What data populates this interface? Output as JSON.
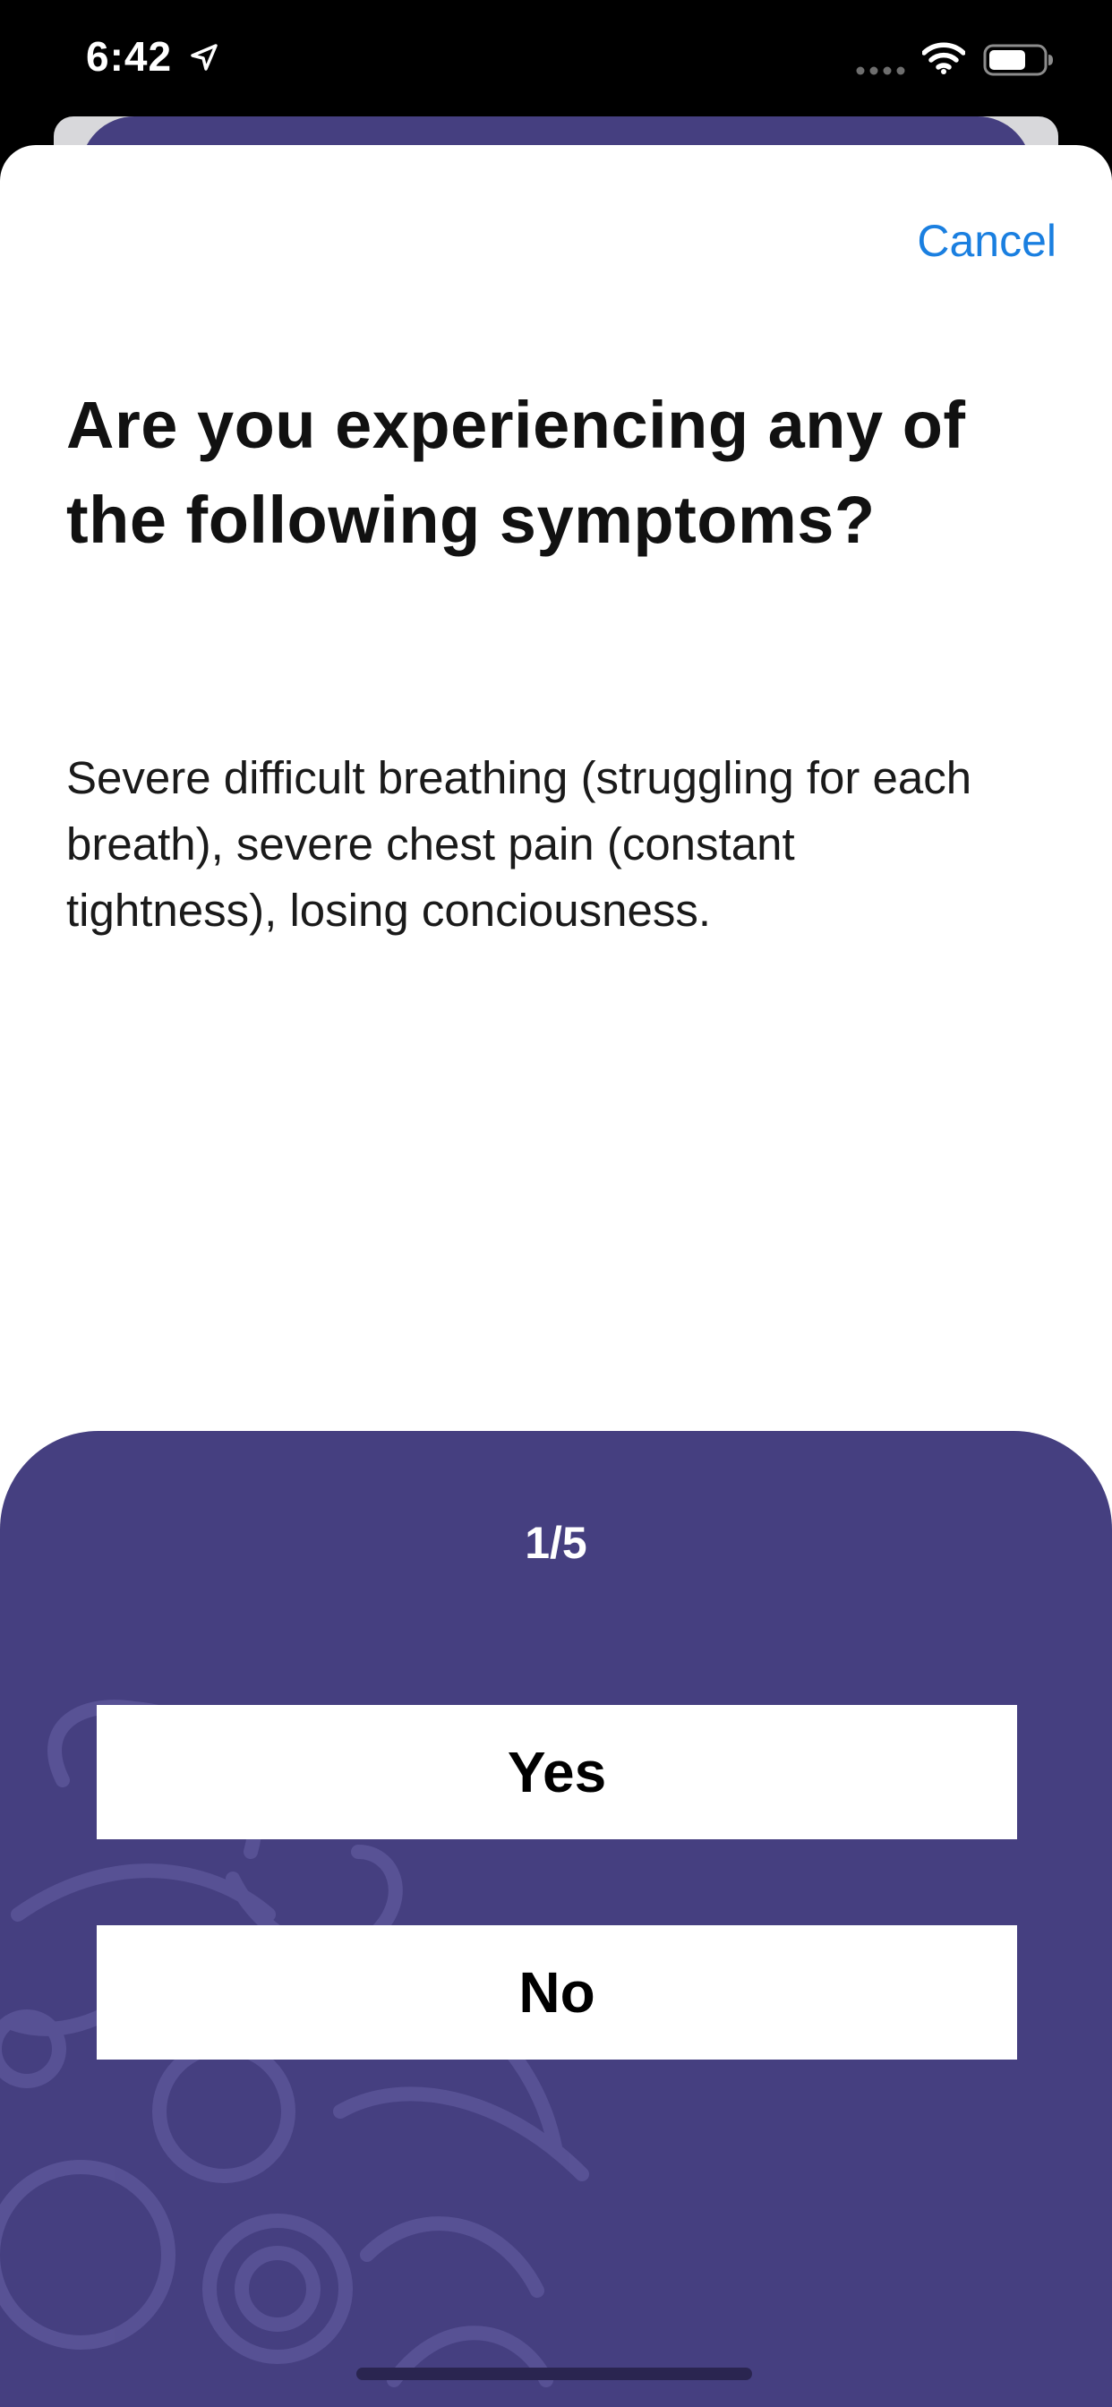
{
  "status_bar": {
    "time": "6:42",
    "icons": [
      "location-arrow-icon",
      "signal-dots-icon",
      "wifi-icon",
      "battery-icon"
    ]
  },
  "header": {
    "cancel_label": "Cancel"
  },
  "question": {
    "title": "Are you experiencing any of the following symptoms?",
    "body": "Severe difficult breathing (struggling for each breath), severe chest pain (constant tightness), losing conciousness."
  },
  "answer_panel": {
    "progress": "1/5",
    "yes_label": "Yes",
    "no_label": "No"
  },
  "colors": {
    "panel": "#453f80",
    "link": "#1a7fe0",
    "background": "#ffffff"
  }
}
